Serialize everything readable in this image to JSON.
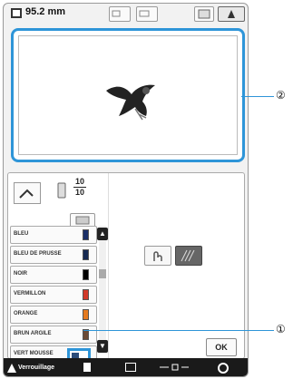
{
  "topbar": {
    "size_value": "95.2 mm",
    "icons": [
      "size-icon",
      "zoom-icon",
      "frame-icon",
      "image-icon",
      "embroidery-icon"
    ]
  },
  "preview": {
    "design": "bird-embroidery"
  },
  "panel": {
    "thread_count_current": "10",
    "thread_count_total": "10",
    "threads": [
      {
        "name": "BLEU",
        "color": "#1a2f68"
      },
      {
        "name": "BLEU DE PRUSSE",
        "color": "#162a52"
      },
      {
        "name": "NOIR",
        "color": "#000000"
      },
      {
        "name": "VERMILLON",
        "color": "#d13a2a"
      },
      {
        "name": "ORANGE",
        "color": "#e57a1f"
      },
      {
        "name": "BRUN ARGILE",
        "color": "#6b4a35"
      },
      {
        "name": "VERT MOUSSE",
        "color": "#3f5d2a"
      }
    ],
    "ok_label": "OK"
  },
  "bottombar": {
    "lock_label": "Verrouillage"
  },
  "callouts": {
    "one": "①",
    "two": "②"
  },
  "colors": {
    "accent": "#2e95d8",
    "bar": "#1a1a1a"
  }
}
